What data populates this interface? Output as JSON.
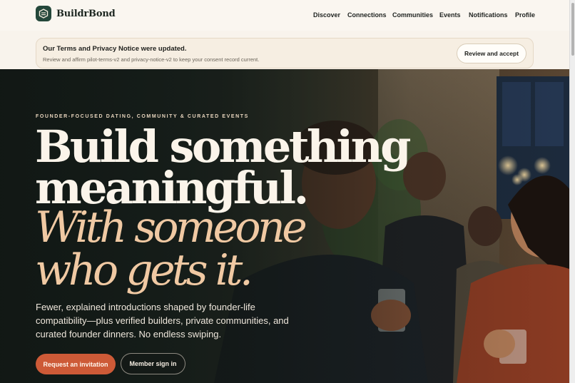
{
  "brand": {
    "name": "BuildrBond",
    "accent": "#24473a"
  },
  "nav": {
    "items": [
      {
        "label": "Discover"
      },
      {
        "label": "Connections"
      },
      {
        "label": "Communities"
      },
      {
        "label": "Events"
      },
      {
        "label": "Notifications"
      },
      {
        "label": "Profile"
      }
    ]
  },
  "notice": {
    "title": "Our Terms and Privacy Notice were updated.",
    "body": "Review and affirm pilot-terms-v2 and privacy-notice-v2 to keep your consent record current.",
    "button_label": "Review and accept"
  },
  "hero": {
    "eyebrow": "FOUNDER-FOCUSED DATING, COMMUNITY & CURATED EVENTS",
    "headline_line1": "Build something",
    "headline_line2": "meaningful.",
    "headline_italic_line1": "With someone",
    "headline_italic_line2": "who gets it.",
    "subtext": "Fewer, explained introductions shaped by founder-life compatibility—plus verified builders, private communities, and curated founder dinners. No endless swiping.",
    "primary_button": "Request an invitation",
    "secondary_button": "Member sign in",
    "primary_color": "#cd5a37",
    "italic_color": "#f0c9a3"
  }
}
